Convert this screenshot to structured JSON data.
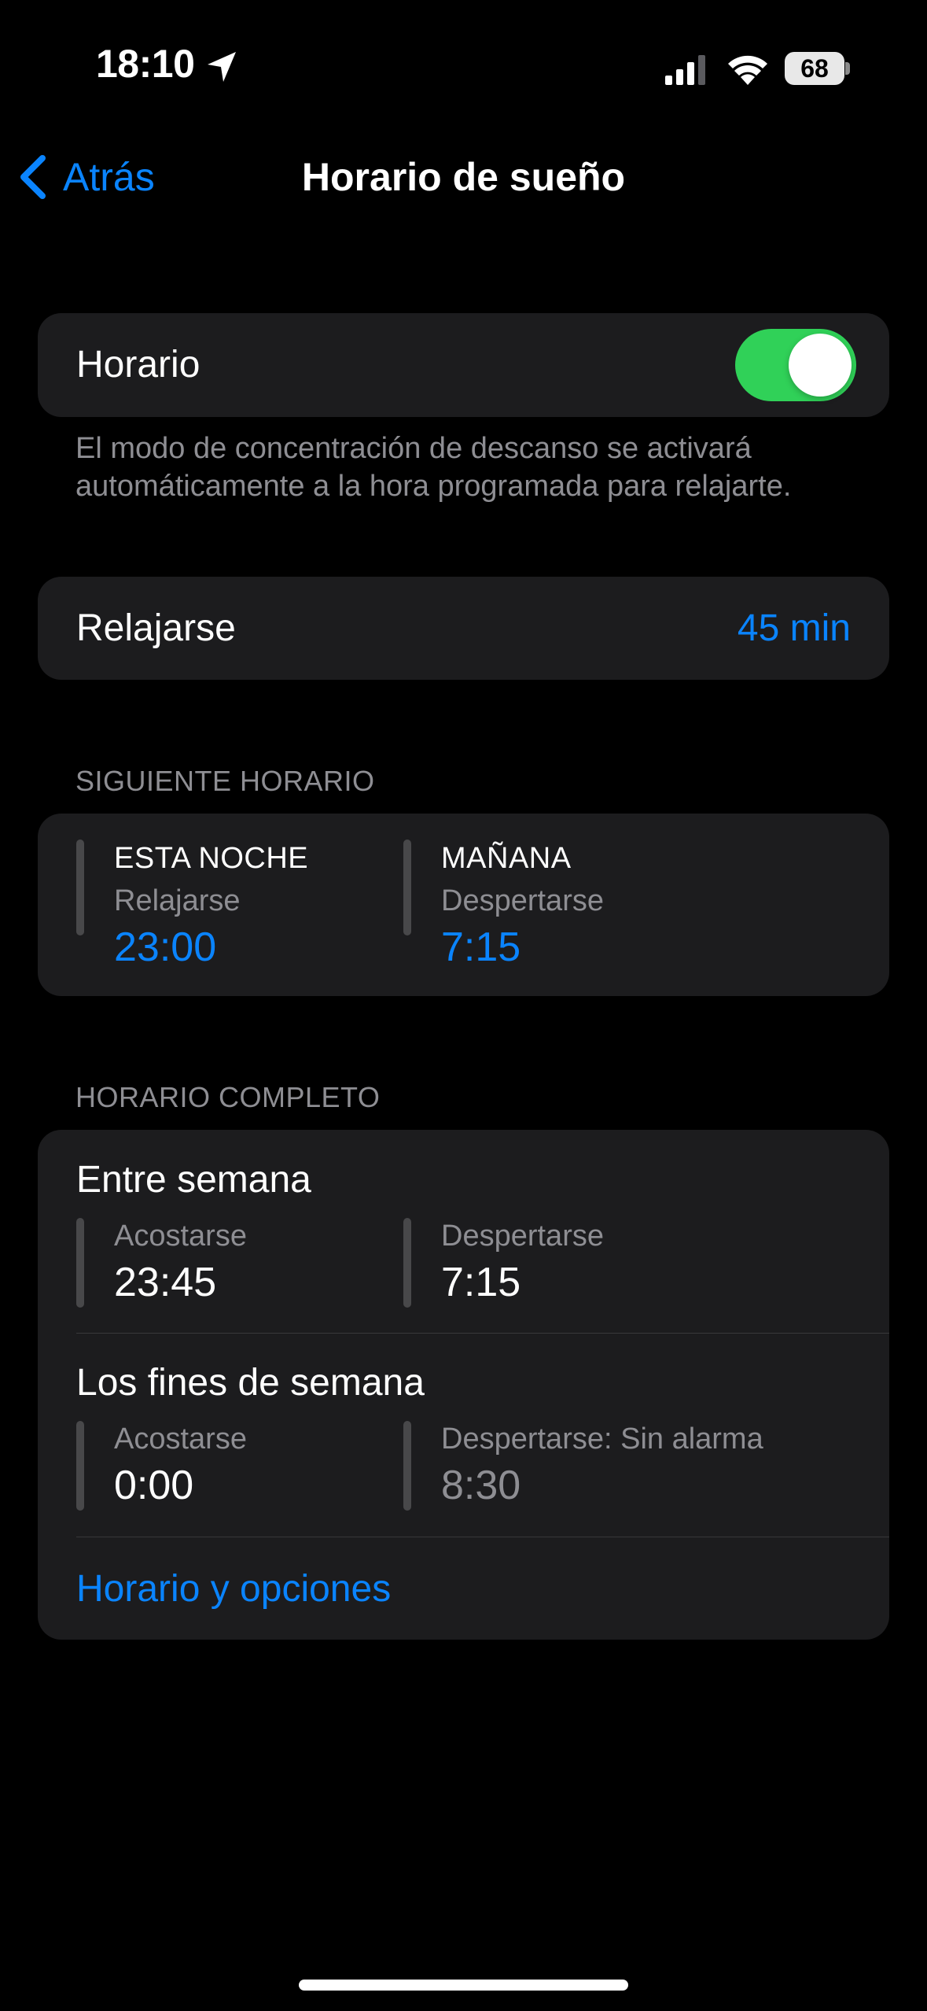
{
  "status_bar": {
    "time": "18:10",
    "battery_level": "68",
    "icons": [
      "location-arrow-icon",
      "cellular-signal-icon",
      "wifi-icon",
      "battery-icon"
    ]
  },
  "nav": {
    "back_label": "Atrás",
    "title": "Horario de sueño"
  },
  "schedule_toggle": {
    "label": "Horario",
    "enabled": true,
    "footnote": "El modo de concentración de descanso se activará automáticamente a la hora programada para relajarte."
  },
  "wind_down": {
    "label": "Relajarse",
    "value": "45 min"
  },
  "next_schedule": {
    "header": "SIGUIENTE HORARIO",
    "tonight": {
      "title": "ESTA NOCHE",
      "subtitle": "Relajarse",
      "time": "23:00"
    },
    "tomorrow": {
      "title": "MAÑANA",
      "subtitle": "Despertarse",
      "time": "7:15"
    }
  },
  "full_schedule": {
    "header": "HORARIO COMPLETO",
    "weekdays": {
      "title": "Entre semana",
      "bedtime_label": "Acostarse",
      "bedtime": "23:45",
      "wake_label": "Despertarse",
      "wake": "7:15"
    },
    "weekends": {
      "title": "Los fines de semana",
      "bedtime_label": "Acostarse",
      "bedtime": "0:00",
      "wake_label": "Despertarse: Sin alarma",
      "wake": "8:30"
    },
    "options_link": "Horario y opciones"
  },
  "colors": {
    "accent": "#0a84ff",
    "toggle_on": "#30d158",
    "card_bg": "#1c1c1e",
    "secondary_text": "#8e8e93"
  }
}
